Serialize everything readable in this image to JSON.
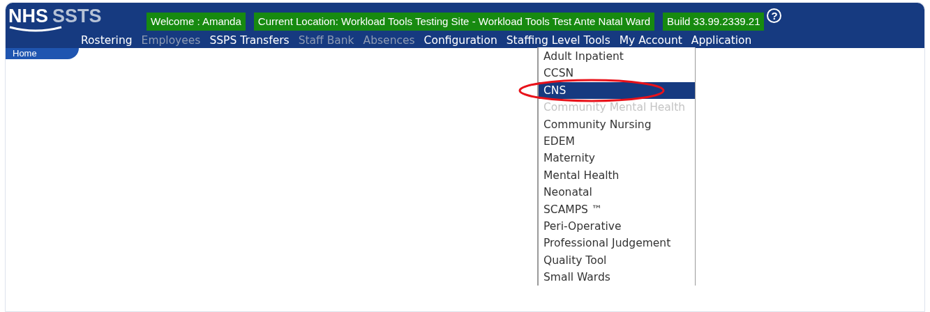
{
  "logo": {
    "mark": "NHS",
    "product": "SSTS"
  },
  "info_badges": [
    "Welcome : Amanda",
    "Current Location: Workload Tools Testing Site - Workload Tools Test Ante Natal Ward",
    "Build 33.99.2339.21"
  ],
  "help": {
    "symbol": "?"
  },
  "menu": [
    {
      "label": "Rostering",
      "disabled": false
    },
    {
      "label": "Employees",
      "disabled": true
    },
    {
      "label": "SSPS Transfers",
      "disabled": false
    },
    {
      "label": "Staff Bank",
      "disabled": true
    },
    {
      "label": "Absences",
      "disabled": true
    },
    {
      "label": "Configuration",
      "disabled": false
    },
    {
      "label": "Staffing Level Tools",
      "disabled": false
    },
    {
      "label": "My Account",
      "disabled": false
    },
    {
      "label": "Application",
      "disabled": false
    }
  ],
  "breadcrumb": "Home",
  "dropdown": [
    {
      "label": "Adult Inpatient",
      "selected": false,
      "disabled": false
    },
    {
      "label": "CCSN",
      "selected": false,
      "disabled": false
    },
    {
      "label": "CNS",
      "selected": true,
      "disabled": false
    },
    {
      "label": "Community Mental Health",
      "selected": false,
      "disabled": true
    },
    {
      "label": "Community Nursing",
      "selected": false,
      "disabled": false
    },
    {
      "label": "EDEM",
      "selected": false,
      "disabled": false
    },
    {
      "label": "Maternity",
      "selected": false,
      "disabled": false
    },
    {
      "label": "Mental Health",
      "selected": false,
      "disabled": false
    },
    {
      "label": "Neonatal",
      "selected": false,
      "disabled": false
    },
    {
      "label": "SCAMPS ™",
      "selected": false,
      "disabled": false
    },
    {
      "label": "Peri-Operative",
      "selected": false,
      "disabled": false
    },
    {
      "label": "Professional Judgement",
      "selected": false,
      "disabled": false
    },
    {
      "label": "Quality Tool",
      "selected": false,
      "disabled": false
    },
    {
      "label": "Small Wards",
      "selected": false,
      "disabled": false
    }
  ],
  "annotation": {
    "highlight": true
  }
}
